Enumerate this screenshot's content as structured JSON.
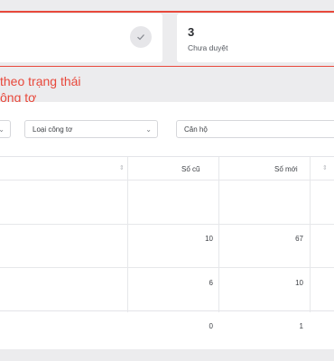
{
  "stats": {
    "left_card": {
      "icon": "check-icon"
    },
    "pending": {
      "count": "3",
      "label": "Chưa duyệt"
    }
  },
  "annotation": {
    "line1": "theo trạng thái",
    "line2": "ông tơ"
  },
  "filters": {
    "meter_type": "Loại công tơ",
    "apartment": "Căn hộ"
  },
  "table": {
    "columns": [
      "Số cũ",
      "Số mới"
    ],
    "rows": [
      {
        "old": "10",
        "new": "67"
      },
      {
        "old": "6",
        "new": "10"
      },
      {
        "old": "0",
        "new": "1"
      }
    ]
  },
  "colors": {
    "annotation_red": "#e8483b",
    "panel_bg": "#ffffff",
    "page_bg": "#ececee"
  }
}
